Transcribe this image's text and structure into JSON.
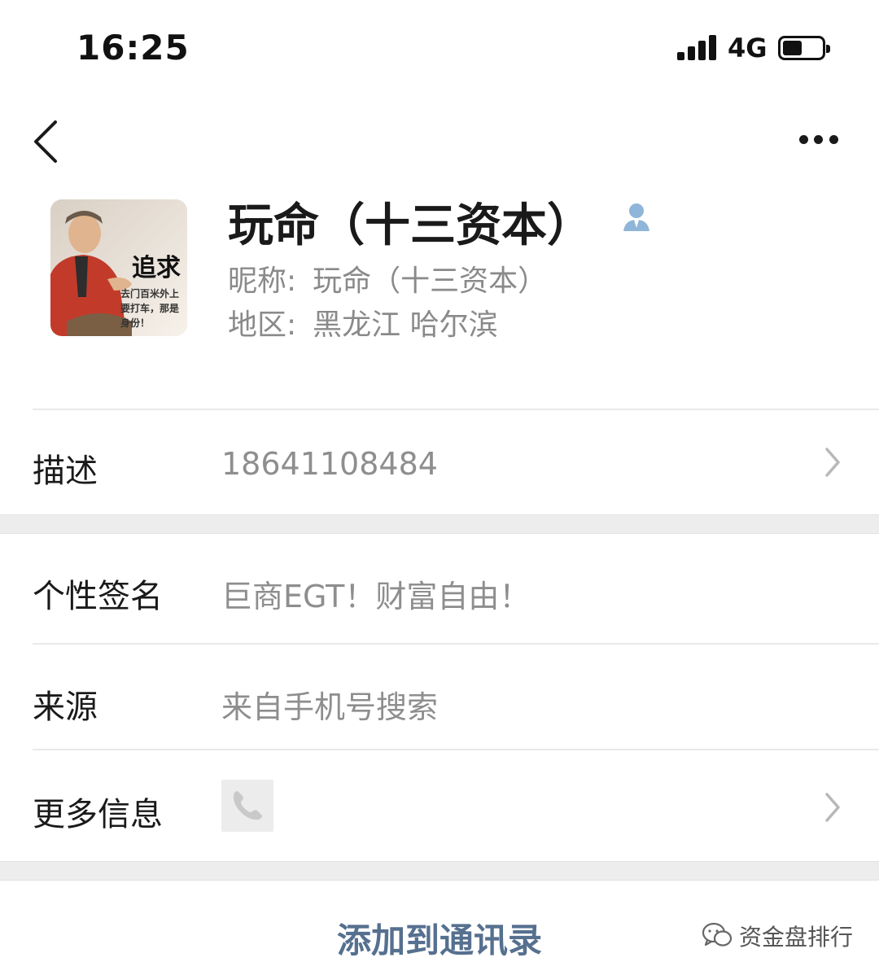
{
  "status_bar": {
    "time": "16:25",
    "network": "4G",
    "signal_bars": 4,
    "battery_level": 0.5
  },
  "nav": {
    "back_icon": "chevron-left-icon",
    "more_icon": "more-dots-icon"
  },
  "profile": {
    "display_name": "玩命（十三资本）",
    "nickname_label": "昵称:",
    "nickname": "玩命（十三资本）",
    "region_label": "地区:",
    "region": "黑龙江 哈尔滨",
    "avatar_overlay": {
      "headline": "追求",
      "line1": "去门百米外上",
      "line2": "要打车，那是",
      "line3": "身份！"
    }
  },
  "rows": {
    "description": {
      "label": "描述",
      "value": "18641108484"
    },
    "signature": {
      "label": "个性签名",
      "value": "巨商EGT！财富自由！"
    },
    "source": {
      "label": "来源",
      "value": "来自手机号搜索"
    },
    "more_info": {
      "label": "更多信息",
      "icon": "phone-icon"
    }
  },
  "actions": {
    "add_to_contacts": "添加到通讯录"
  },
  "watermark": {
    "text": "资金盘排行"
  },
  "colors": {
    "action_text": "#56708f",
    "secondary_text": "#8a8a8a",
    "section_gap": "#ededed"
  }
}
